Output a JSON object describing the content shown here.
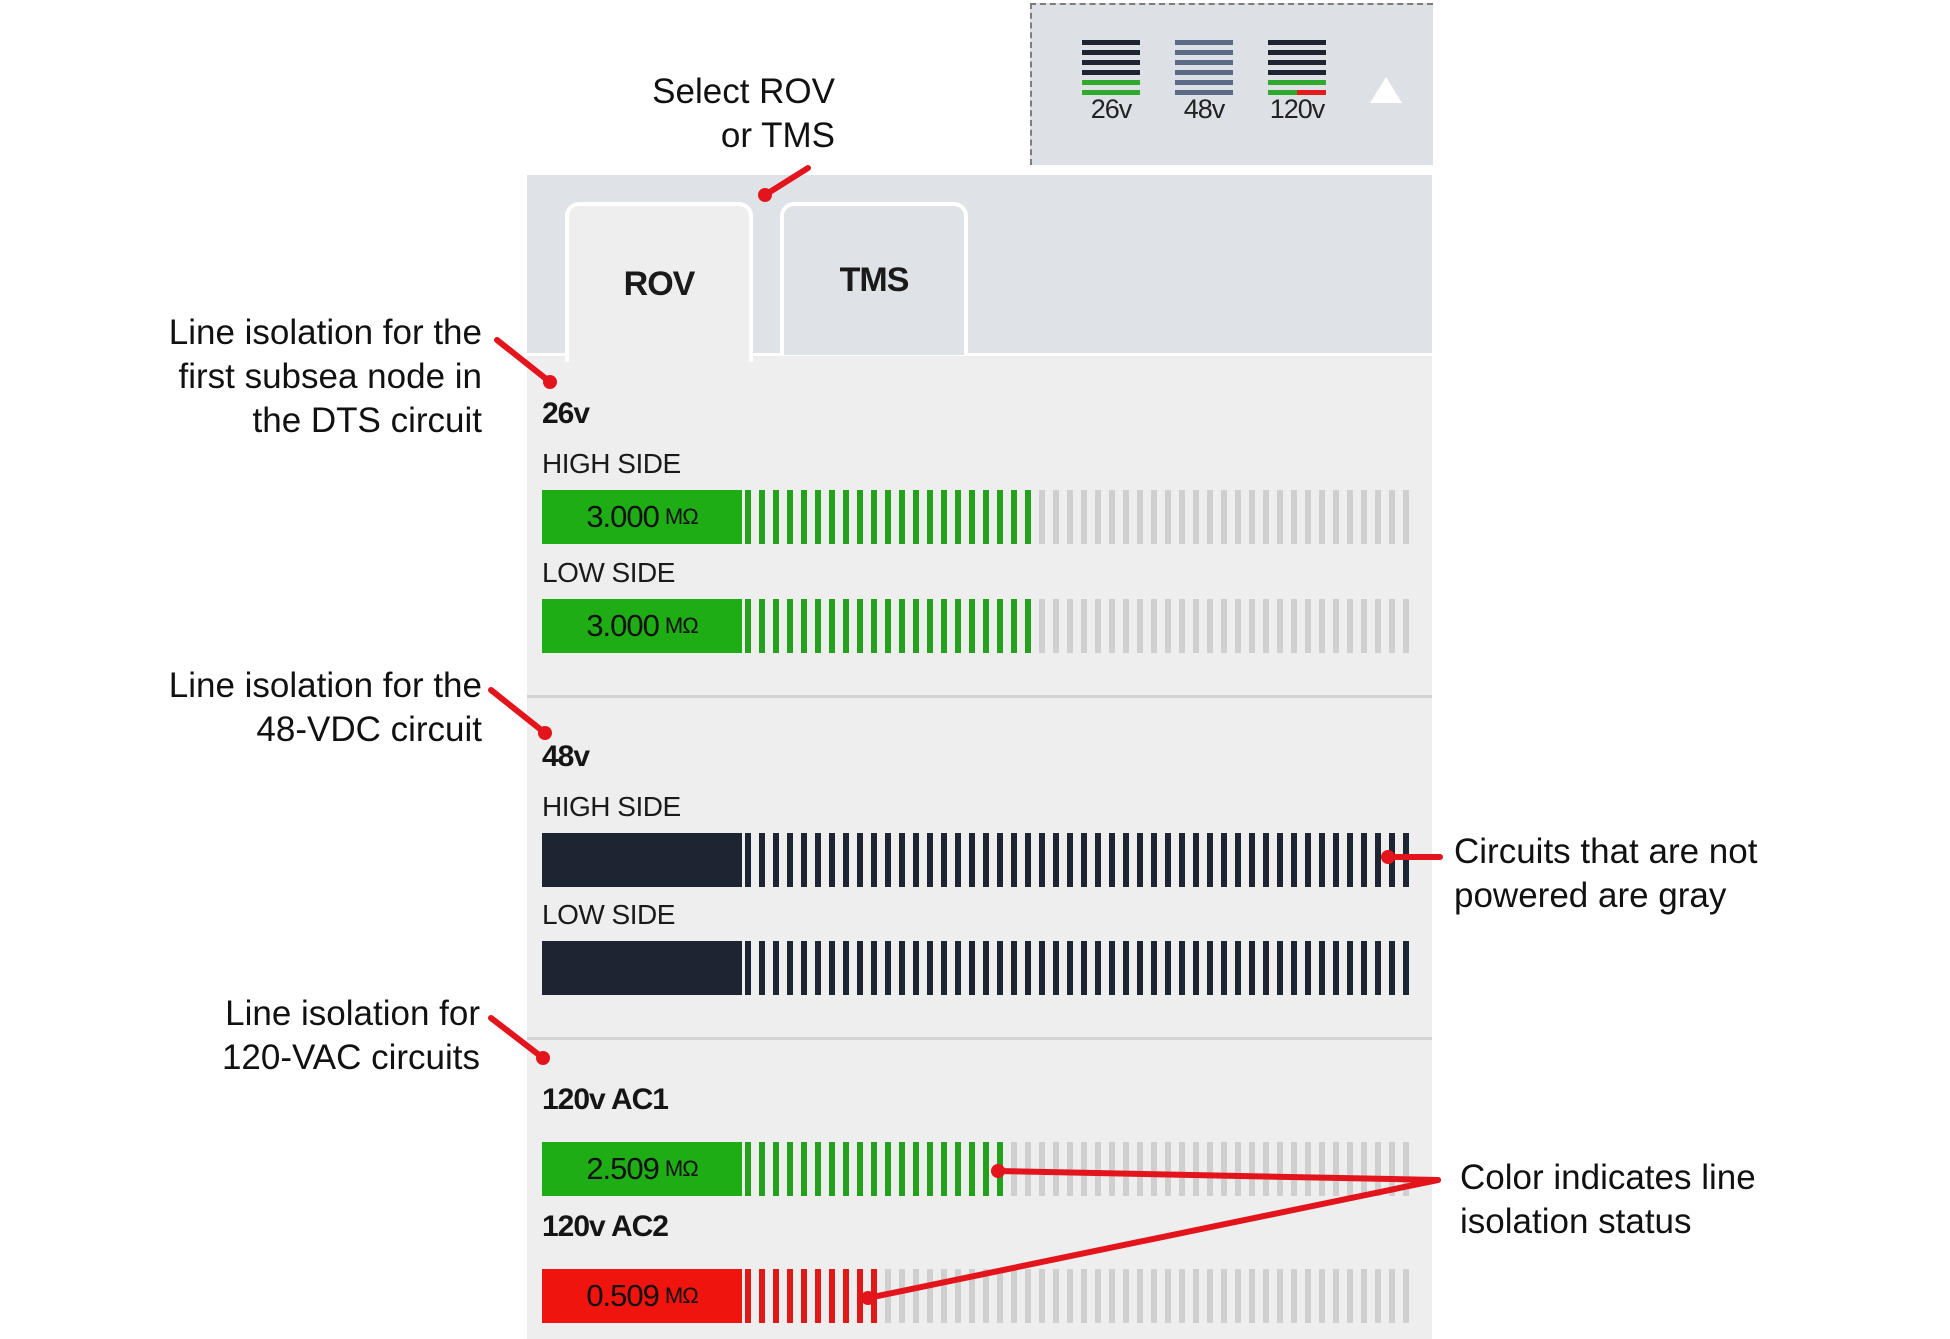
{
  "status_widget": {
    "items": [
      {
        "label": "26v",
        "state": "ok"
      },
      {
        "label": "48v",
        "state": "unpowered"
      },
      {
        "label": "120v",
        "state": "alarm"
      }
    ],
    "collapse_icon": "triangle-up-icon"
  },
  "tabs": [
    {
      "label": "ROV",
      "active": true
    },
    {
      "label": "TMS",
      "active": false
    }
  ],
  "sections": {
    "s26": {
      "title": "26v",
      "high": {
        "label": "HIGH SIDE",
        "value": "3.000",
        "unit": "MΩ",
        "status": "green",
        "fill_fraction": 0.43
      },
      "low": {
        "label": "LOW SIDE",
        "value": "3.000",
        "unit": "MΩ",
        "status": "green",
        "fill_fraction": 0.43
      }
    },
    "s48": {
      "title": "48v",
      "high": {
        "label": "HIGH SIDE",
        "value": "",
        "unit": "",
        "status": "unpowered",
        "fill_fraction": 1.0
      },
      "low": {
        "label": "LOW SIDE",
        "value": "",
        "unit": "",
        "status": "unpowered",
        "fill_fraction": 1.0
      }
    },
    "s120": {
      "ac1": {
        "title": "120v AC1",
        "value": "2.509",
        "unit": "MΩ",
        "status": "green",
        "fill_fraction": 0.4
      },
      "ac2": {
        "title": "120v AC2",
        "value": "0.509",
        "unit": "MΩ",
        "status": "red",
        "fill_fraction": 0.2
      }
    }
  },
  "colors": {
    "green": "#1fad16",
    "green_seg": "#23a01c",
    "red": "#f0140f",
    "red_seg": "#e01818",
    "unpowered": "#1f2433",
    "empty_seg": "#cfcfcf",
    "annotation_red": "#e3141b"
  },
  "annotations": {
    "select": [
      "Select ROV",
      "or TMS"
    ],
    "line26": [
      "Line isolation for the",
      "first subsea node in",
      "the DTS circuit"
    ],
    "line48": [
      "Line isolation for the",
      "48-VDC circuit"
    ],
    "line120": [
      "Line isolation for",
      "120-VAC circuits"
    ],
    "gray": [
      "Circuits that are not",
      "powered are gray"
    ],
    "color": [
      "Color indicates line",
      "isolation status"
    ]
  }
}
